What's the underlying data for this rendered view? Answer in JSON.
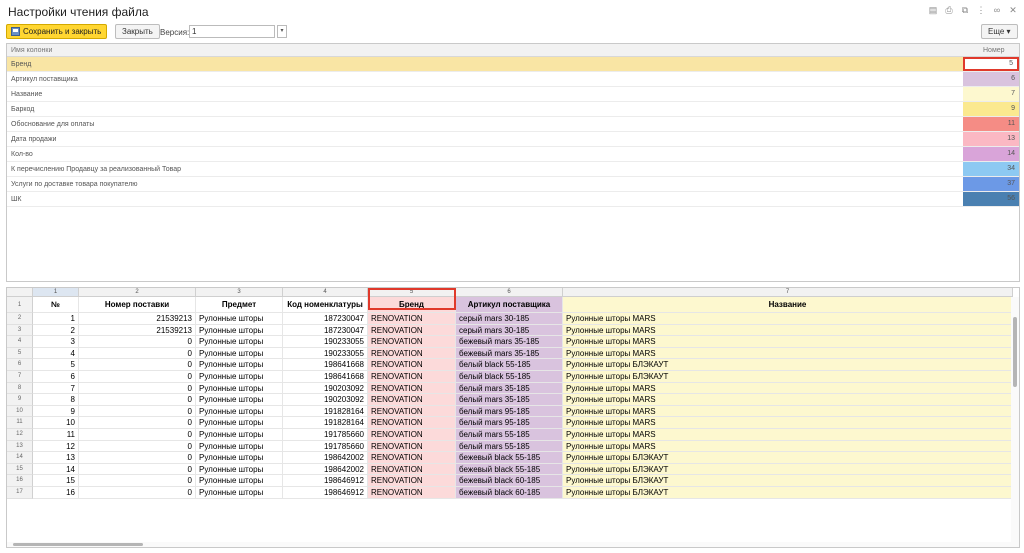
{
  "window": {
    "title": "Настройки чтения файла"
  },
  "toolbar": {
    "save_label": "Сохранить и закрыть",
    "close_label": "Закрыть",
    "version_label": "Версия:",
    "version_value": "1",
    "more_label": "Еще ▾"
  },
  "mapping": {
    "header_name": "Имя колонки",
    "header_number": "Номер",
    "rows": [
      {
        "name": "Бренд",
        "number": "5",
        "color": "#fde7a8"
      },
      {
        "name": "Артикул поставщика",
        "number": "6",
        "color": "#d9c3de"
      },
      {
        "name": "Название",
        "number": "7",
        "color": "#fdf8cf"
      },
      {
        "name": "Баркод",
        "number": "9",
        "color": "#fbe98f"
      },
      {
        "name": "Обоснование для оплаты",
        "number": "11",
        "color": "#f58c85"
      },
      {
        "name": "Дата продажи",
        "number": "13",
        "color": "#fbb8c3"
      },
      {
        "name": "Кол-во",
        "number": "14",
        "color": "#d9a4d9"
      },
      {
        "name": "К перечислению Продавцу за реализованный Товар",
        "number": "34",
        "color": "#8dc9f2"
      },
      {
        "name": "Услуги по доставке товара покупателю",
        "number": "37",
        "color": "#6c99e6"
      },
      {
        "name": "ШК",
        "number": "56",
        "color": "#4a80b1"
      }
    ]
  },
  "sheet": {
    "col_numbers": [
      "1",
      "2",
      "3",
      "4",
      "5",
      "6",
      "7"
    ],
    "row_numbers": [
      "1",
      "2",
      "3",
      "4",
      "5",
      "6",
      "7",
      "8",
      "9",
      "10",
      "11",
      "12",
      "13",
      "14",
      "15",
      "16",
      "17"
    ],
    "headers": [
      "№",
      "Номер поставки",
      "Предмет",
      "Код номенклатуры",
      "Бренд",
      "Артикул поставщика",
      "Название"
    ],
    "rows": [
      [
        "1",
        "21539213",
        "Рулонные шторы",
        "187230047",
        "RENOVATION",
        "серый mars 30-185",
        "Рулонные шторы MARS"
      ],
      [
        "2",
        "21539213",
        "Рулонные шторы",
        "187230047",
        "RENOVATION",
        "серый mars 30-185",
        "Рулонные шторы MARS"
      ],
      [
        "3",
        "0",
        "Рулонные шторы",
        "190233055",
        "RENOVATION",
        "бежевый mars 35-185",
        "Рулонные шторы MARS"
      ],
      [
        "4",
        "0",
        "Рулонные шторы",
        "190233055",
        "RENOVATION",
        "бежевый mars 35-185",
        "Рулонные шторы MARS"
      ],
      [
        "5",
        "0",
        "Рулонные шторы",
        "198641668",
        "RENOVATION",
        "белый black 55-185",
        "Рулонные шторы БЛЭКАУТ"
      ],
      [
        "6",
        "0",
        "Рулонные шторы",
        "198641668",
        "RENOVATION",
        "белый black 55-185",
        "Рулонные шторы БЛЭКАУТ"
      ],
      [
        "7",
        "0",
        "Рулонные шторы",
        "190203092",
        "RENOVATION",
        "белый mars 35-185",
        "Рулонные шторы MARS"
      ],
      [
        "8",
        "0",
        "Рулонные шторы",
        "190203092",
        "RENOVATION",
        "белый mars 35-185",
        "Рулонные шторы MARS"
      ],
      [
        "9",
        "0",
        "Рулонные шторы",
        "191828164",
        "RENOVATION",
        "белый mars 95-185",
        "Рулонные шторы MARS"
      ],
      [
        "10",
        "0",
        "Рулонные шторы",
        "191828164",
        "RENOVATION",
        "белый mars 95-185",
        "Рулонные шторы MARS"
      ],
      [
        "11",
        "0",
        "Рулонные шторы",
        "191785660",
        "RENOVATION",
        "белый mars 55-185",
        "Рулонные шторы MARS"
      ],
      [
        "12",
        "0",
        "Рулонные шторы",
        "191785660",
        "RENOVATION",
        "белый mars 55-185",
        "Рулонные шторы MARS"
      ],
      [
        "13",
        "0",
        "Рулонные шторы",
        "198642002",
        "RENOVATION",
        "бежевый black 55-185",
        "Рулонные шторы БЛЭКАУТ"
      ],
      [
        "14",
        "0",
        "Рулонные шторы",
        "198642002",
        "RENOVATION",
        "бежевый black 55-185",
        "Рулонные шторы БЛЭКАУТ"
      ],
      [
        "15",
        "0",
        "Рулонные шторы",
        "198646912",
        "RENOVATION",
        "бежевый black 60-185",
        "Рулонные шторы БЛЭКАУТ"
      ],
      [
        "16",
        "0",
        "Рулонные шторы",
        "198646912",
        "RENOVATION",
        "бежевый black 60-185",
        "Рулонные шторы БЛЭКАУТ"
      ]
    ],
    "col_colors": [
      "#ffffff",
      "#ffffff",
      "#ffffff",
      "#ffffff",
      "#fcdada",
      "#d9c3de",
      "#fdf8cf"
    ]
  }
}
